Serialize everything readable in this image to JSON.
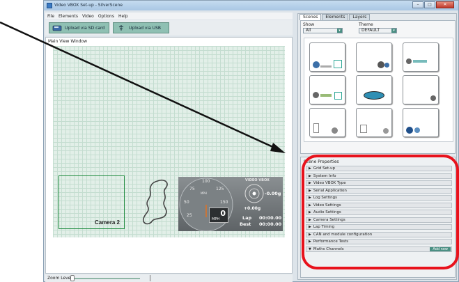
{
  "window": {
    "title": "Video VBOX Set-up - SilverScene"
  },
  "menu": [
    "File",
    "Elements",
    "Video",
    "Options",
    "Help"
  ],
  "upload": {
    "sd_label": "Upload via SD card",
    "usb_label": "Upload via USB"
  },
  "main_view": {
    "label": "Main View Window",
    "camera_label": "Camera 2",
    "gauge": {
      "ticks": [
        "100",
        "75",
        "125",
        "50",
        "150",
        "25"
      ],
      "unit": "MPH",
      "speed": "0",
      "speed_unit": "MPH"
    },
    "gforce": {
      "lateral": "-0.00g",
      "longitudinal": "+0.00g",
      "brand": "VIDEO VBOX"
    },
    "lap": {
      "lap_label": "Lap",
      "lap_time": "00:00.00",
      "best_label": "Best",
      "best_time": "00:00.00"
    }
  },
  "zoom": {
    "label": "Zoom Level"
  },
  "right_tabs": [
    "Scenes",
    "Elements",
    "Layers"
  ],
  "scenes": {
    "show_label": "Show",
    "show_value": "All",
    "theme_label": "Theme",
    "theme_value": "DEFAULT"
  },
  "scene_properties": {
    "title": "Scene Properties",
    "items": [
      "Grid Set-up",
      "System Info",
      "Video VBOX Type",
      "Serial Application",
      "Log Settings",
      "Video Settings",
      "Audio Settings",
      "Camera Settings",
      "Lap Timing",
      "CAN and module configuration",
      "Performance Tests",
      "Maths Channels"
    ],
    "add_new": "Add new"
  },
  "colors": {
    "highlight_ring": "#e8121c",
    "accent": "#4a8f83",
    "camera_border": "#1c8a3c"
  }
}
